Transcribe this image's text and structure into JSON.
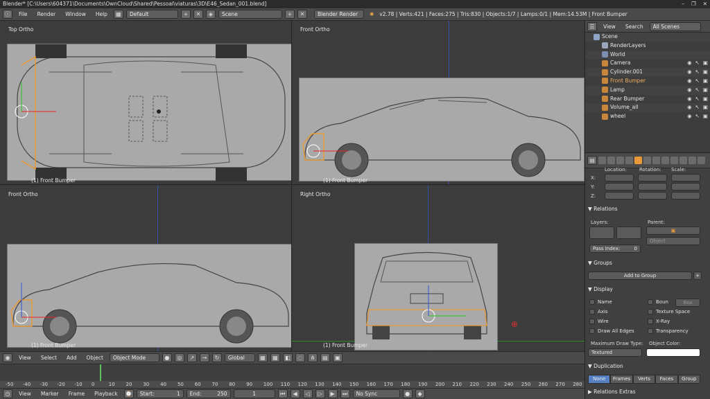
{
  "titlebar": {
    "title": "Blender* [C:\\Users\\604371\\Documents\\OwnCloud\\Shared\\Pessoal\\viaturas\\3D\\E46_Sedan_001.blend]",
    "controls": [
      "–",
      "❐",
      "✕"
    ]
  },
  "infobar": {
    "menus": [
      "File",
      "Render",
      "Window",
      "Help"
    ],
    "layout": "Default",
    "scene": "Scene",
    "engine": "Blender Render",
    "stats": "v2.78 | Verts:421 | Faces:275 | Tris:830 | Objects:1/7 | Lamps:0/1 | Mem:14.53M | Front Bumper"
  },
  "viewports": {
    "top_left": {
      "title": "Top Ortho",
      "object": "(1) Front Bumper"
    },
    "top_right": {
      "title": "Front Ortho",
      "object": "(1) Front Bumper"
    },
    "bottom_left": {
      "title": "Front Ortho",
      "object": "(1) Front Bumper"
    },
    "bottom_right": {
      "title": "Right Ortho",
      "object": "(1) Front Bumper"
    }
  },
  "view3d_header": {
    "menus": [
      "View",
      "Select",
      "Add",
      "Object"
    ],
    "mode": "Object Mode",
    "orientation": "Global"
  },
  "timeline": {
    "ticks": [
      "-50",
      "-40",
      "-30",
      "-20",
      "-10",
      "0",
      "10",
      "20",
      "30",
      "40",
      "50",
      "60",
      "70",
      "80",
      "90",
      "100",
      "110",
      "120",
      "130",
      "140",
      "150",
      "160",
      "170",
      "180",
      "190",
      "200",
      "210",
      "220",
      "230",
      "240",
      "250",
      "260",
      "270",
      "280"
    ],
    "menus": [
      "View",
      "Marker",
      "Frame",
      "Playback"
    ],
    "start_label": "Start:",
    "start": "1",
    "end_label": "End:",
    "end": "250",
    "current": "1",
    "sync": "No Sync"
  },
  "outliner": {
    "menus": [
      "View",
      "Search"
    ],
    "filter": "All Scenes",
    "items": [
      {
        "label": "Scene",
        "indent": 0,
        "color": "#8fa3c8"
      },
      {
        "label": "RenderLayers",
        "indent": 1,
        "color": "#9aa6bb"
      },
      {
        "label": "World",
        "indent": 1,
        "color": "#7d8fb0"
      },
      {
        "label": "Camera",
        "indent": 1,
        "color": "#c8863c"
      },
      {
        "label": "Cylinder.001",
        "indent": 1,
        "color": "#c8863c"
      },
      {
        "label": "Front Bumper",
        "indent": 1,
        "color": "#c8863c",
        "selected": true
      },
      {
        "label": "Lamp",
        "indent": 1,
        "color": "#c8863c"
      },
      {
        "label": "Rear Bumper",
        "indent": 1,
        "color": "#c8863c"
      },
      {
        "label": "Volume_all",
        "indent": 1,
        "color": "#c8863c"
      },
      {
        "label": "wheel",
        "indent": 1,
        "color": "#c8863c"
      }
    ]
  },
  "properties": {
    "transform_headers": [
      "Location:",
      "Rotation:",
      "Scale:"
    ],
    "axes": [
      "X:",
      "Y:",
      "Z:"
    ],
    "relations": {
      "title": "Relations",
      "layers": "Layers:",
      "parent": "Parent:",
      "parent_type": "Object",
      "pass_index_label": "Pass Index:",
      "pass_index": "0"
    },
    "groups": {
      "title": "Groups",
      "add": "Add to Group"
    },
    "display": {
      "title": "Display",
      "left": [
        "Name",
        "Axis",
        "Wire",
        "Draw All Edges"
      ],
      "right": [
        "Boun",
        "Texture Space",
        "X-Ray",
        "Transparency"
      ],
      "bounds_type": "Box",
      "max_draw_label": "Maximum Draw Type:",
      "max_draw": "Textured",
      "color_label": "Object Color:"
    },
    "duplication": {
      "title": "Duplication",
      "options": [
        "None",
        "Frames",
        "Verts",
        "Faces",
        "Group"
      ]
    },
    "relations_extras": "Relations Extras"
  }
}
